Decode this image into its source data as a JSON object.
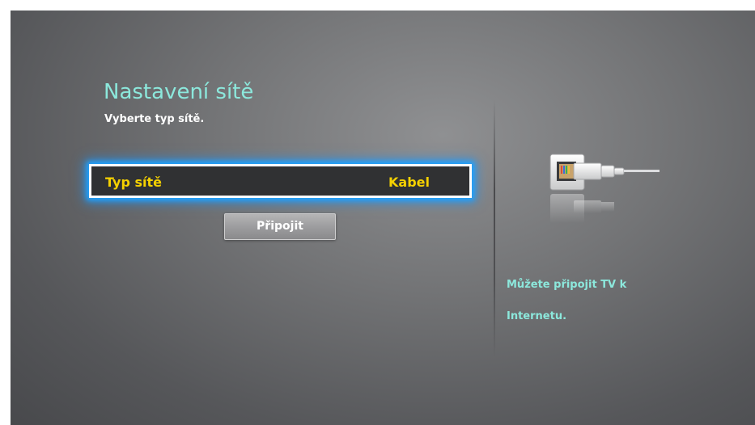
{
  "header": {
    "title": "Nastavení sítě",
    "subtitle": "Vyberte typ sítě."
  },
  "network_type": {
    "label": "Typ sítě",
    "value": "Kabel"
  },
  "connect_button": {
    "label": "Připojit"
  },
  "info": {
    "line1": "Můžete připojit TV k",
    "line2": "Internetu."
  },
  "colors": {
    "title_accent": "#8ce8dc",
    "selected_text": "#f5d100",
    "focus_glow": "#1ea3ff"
  },
  "icons": {
    "illustration": "ethernet-cable-icon"
  }
}
